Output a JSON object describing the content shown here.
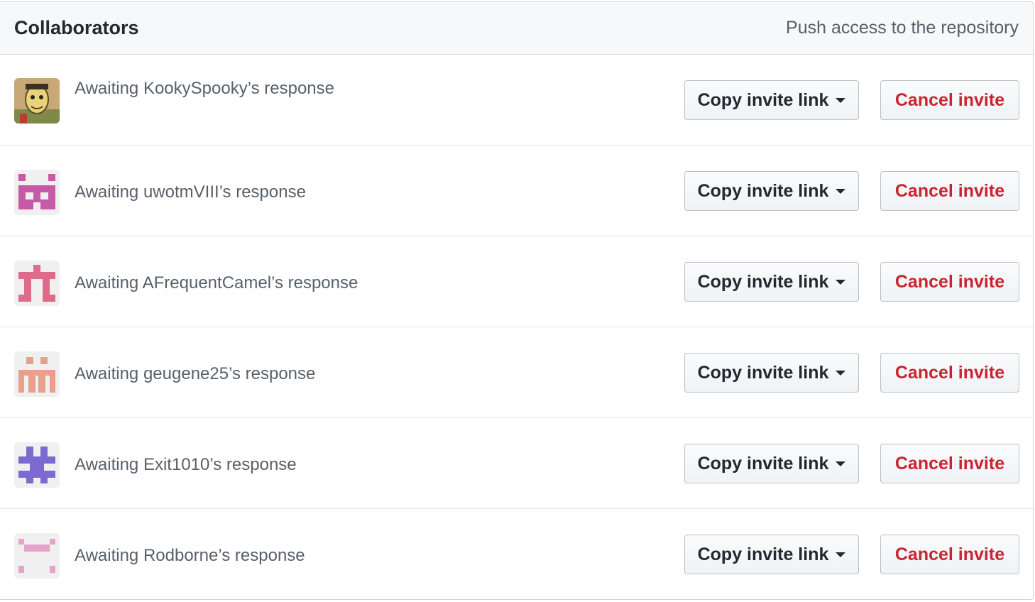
{
  "header": {
    "title": "Collaborators",
    "note": "Push access to the repository"
  },
  "buttons": {
    "copy_label": "Copy invite link",
    "cancel_label": "Cancel invite"
  },
  "colors": {
    "cancel_text": "#cb2431",
    "header_bg": "#f6f8fa",
    "border": "#d1d5da"
  },
  "invites": [
    {
      "text": "Awaiting KookySpooky’s response",
      "avatar": "cartoon-avatar"
    },
    {
      "text": "Awaiting uwotmVIII’s response",
      "avatar": "identicon-magenta",
      "avatar_color": "#c75aa6"
    },
    {
      "text": "Awaiting AFrequentCamel’s response",
      "avatar": "identicon-pink",
      "avatar_color": "#e06a8a"
    },
    {
      "text": "Awaiting geugene25’s response",
      "avatar": "identicon-salmon",
      "avatar_color": "#e8a08c"
    },
    {
      "text": "Awaiting Exit1010’s response",
      "avatar": "identicon-purple",
      "avatar_color": "#7d6ad0"
    },
    {
      "text": "Awaiting Rodborne’s response",
      "avatar": "identicon-lightpink",
      "avatar_color": "#e6a2c8"
    }
  ]
}
